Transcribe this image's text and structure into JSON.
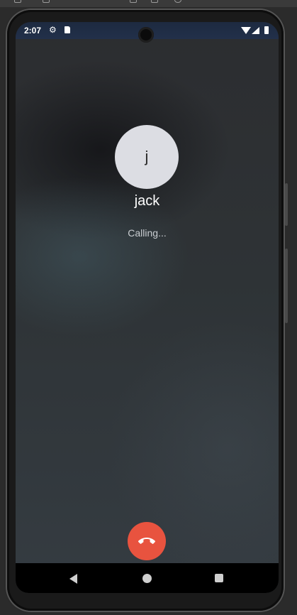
{
  "status_bar": {
    "time": "2:07",
    "icons": [
      "gear-icon",
      "sd-card-icon",
      "wifi-icon",
      "signal-icon",
      "battery-icon"
    ]
  },
  "call": {
    "avatar_initial": "j",
    "contact_name": "jack",
    "status": "Calling..."
  },
  "actions": {
    "end_call_icon": "phone-hangup-icon",
    "end_call_color": "#e8533f"
  },
  "nav_bar": {
    "buttons": [
      "back-icon",
      "home-icon",
      "recents-icon"
    ]
  }
}
